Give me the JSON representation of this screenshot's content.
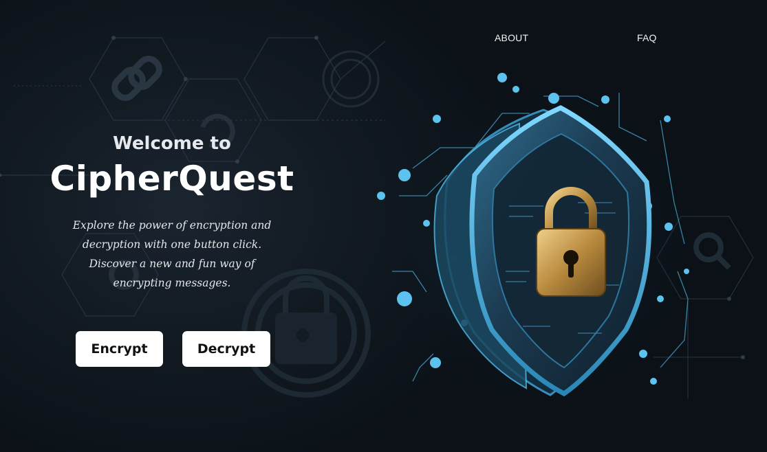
{
  "nav": {
    "about_label": "ABOUT",
    "faq_label": "FAQ"
  },
  "hero": {
    "welcome": "Welcome to",
    "brand": "CipherQuest",
    "tagline": "Explore the power of encryption and decryption with one button click. Discover a new and fun way of encrypting messages."
  },
  "actions": {
    "encrypt_label": "Encrypt",
    "decrypt_label": "Decrypt"
  },
  "illustration": {
    "icon": "security-shield-padlock-illustration"
  },
  "colors": {
    "background": "#0b1117",
    "accent_cyan": "#3fb8e6",
    "lock_gold": "#c9a25a",
    "button_bg": "#ffffff",
    "button_text": "#111111"
  }
}
